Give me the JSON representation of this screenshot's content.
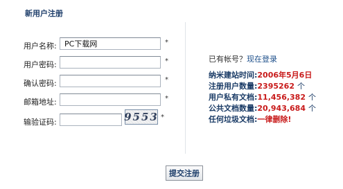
{
  "form": {
    "title": "新用户注册",
    "fields": [
      {
        "label": "用户名称:",
        "value": "PC下载网",
        "required": "*"
      },
      {
        "label": "用户密码:",
        "value": "",
        "required": "*"
      },
      {
        "label": "确认密码:",
        "value": "",
        "required": "*"
      },
      {
        "label": "邮箱地址:",
        "value": "",
        "required": "*"
      }
    ],
    "captcha": {
      "label": "输验证码:",
      "value": "",
      "code": "9553",
      "required": "*"
    },
    "submit_label": "提交注册"
  },
  "login": {
    "prompt": "已有帐号？",
    "link_label": "现在登录"
  },
  "stats": [
    {
      "label": "纳米建站时间:",
      "value": "2006年5月6日",
      "unit": ""
    },
    {
      "label": "注册用户数量:",
      "value": "2395262",
      "unit": "个"
    },
    {
      "label": "用户私有文档:",
      "value": "11,456,382",
      "unit": "个"
    },
    {
      "label": "公共文档数量:",
      "value": "20,943,684",
      "unit": "个"
    },
    {
      "label": "任何垃圾文档:",
      "value": "一律删除!",
      "unit": ""
    }
  ]
}
